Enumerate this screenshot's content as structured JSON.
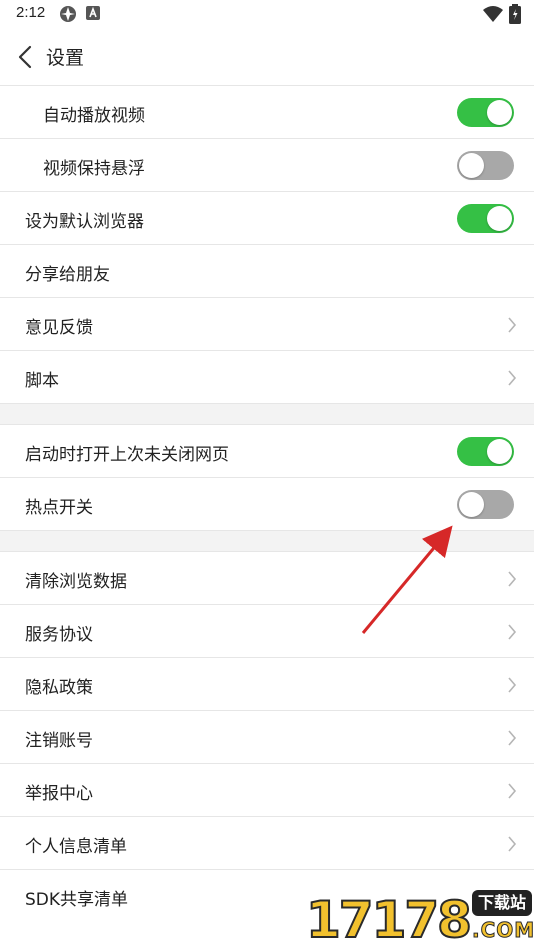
{
  "status_bar": {
    "time": "2:12"
  },
  "header": {
    "title": "设置"
  },
  "groups": {
    "autoplay_video": {
      "label": "自动播放视频",
      "toggle": "on"
    },
    "video_float": {
      "label": "视频保持悬浮",
      "toggle": "off"
    },
    "default_browser": {
      "label": "设为默认浏览器",
      "toggle": "on"
    },
    "share": {
      "label": "分享给朋友"
    },
    "feedback": {
      "label": "意见反馈"
    },
    "script": {
      "label": "脚本"
    },
    "restore_tabs": {
      "label": "启动时打开上次未关闭网页",
      "toggle": "on"
    },
    "hotspot": {
      "label": "热点开关",
      "toggle": "off"
    },
    "clear_data": {
      "label": "清除浏览数据"
    },
    "service_agreement": {
      "label": "服务协议"
    },
    "privacy_policy": {
      "label": "隐私政策"
    },
    "delete_account": {
      "label": "注销账号"
    },
    "report_center": {
      "label": "举报中心"
    },
    "personal_info_list": {
      "label": "个人信息清单"
    },
    "sdk_share_list": {
      "label": "SDK共享清单"
    }
  },
  "colors": {
    "toggle_on": "#35c045",
    "toggle_off": "#a8a8a8",
    "annotation_arrow": "#d62828"
  },
  "watermark": {
    "digits": "17178",
    "tag": "下载站",
    "suffix": ".COM"
  }
}
